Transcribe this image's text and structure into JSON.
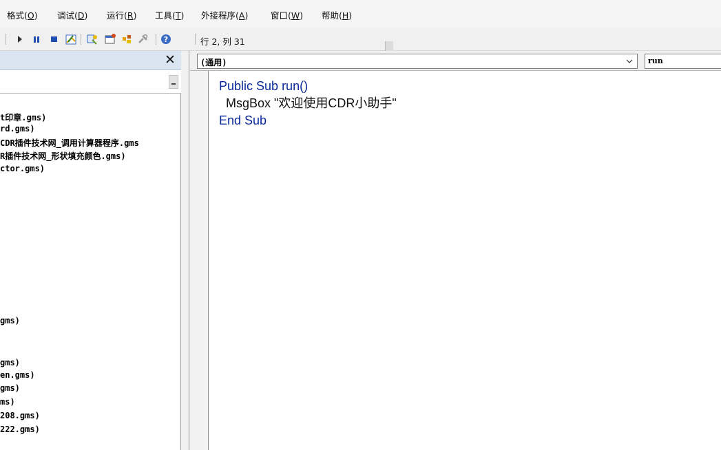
{
  "menu": {
    "items": [
      {
        "label": "格式(",
        "key": "O",
        "tail": ")"
      },
      {
        "label": "调试(",
        "key": "D",
        "tail": ")"
      },
      {
        "label": "运行(",
        "key": "R",
        "tail": ")"
      },
      {
        "label": "工具(",
        "key": "T",
        "tail": ")"
      },
      {
        "label": "外接程序(",
        "key": "A",
        "tail": ")"
      },
      {
        "label": "窗口(",
        "key": "W",
        "tail": ")"
      },
      {
        "label": "帮助(",
        "key": "H",
        "tail": ")"
      }
    ]
  },
  "toolbar": {
    "icons": [
      "run-icon",
      "pause-icon",
      "stop-icon",
      "design-mode-icon",
      "project-explorer-icon",
      "properties-icon",
      "object-browser-icon",
      "toolbox-icon",
      "help-icon"
    ],
    "cursor_position": "行 2, 列 31"
  },
  "project_panel": {
    "close_label": "✕",
    "items": [
      "t印章.gms)",
      "rd.gms)",
      "CDR插件技术网_调用计算器程序.gms",
      "R插件技术网_形状填充颜色.gms)",
      "ctor.gms)",
      "gms)",
      "gms)",
      "en.gms)",
      "gms)",
      "ms)",
      "208.gms)",
      "222.gms)"
    ]
  },
  "editor": {
    "object_combo": "(通用)",
    "procedure_combo": "run",
    "code": {
      "line1_kw": "Public Sub",
      "line1_rest": " run()",
      "line2": "  MsgBox \"欢迎使用CDR小助手\"",
      "line3_kw": "End Sub"
    }
  },
  "colors": {
    "keyword": "#0a2a9a",
    "panel_header": "#dbe4f1"
  }
}
